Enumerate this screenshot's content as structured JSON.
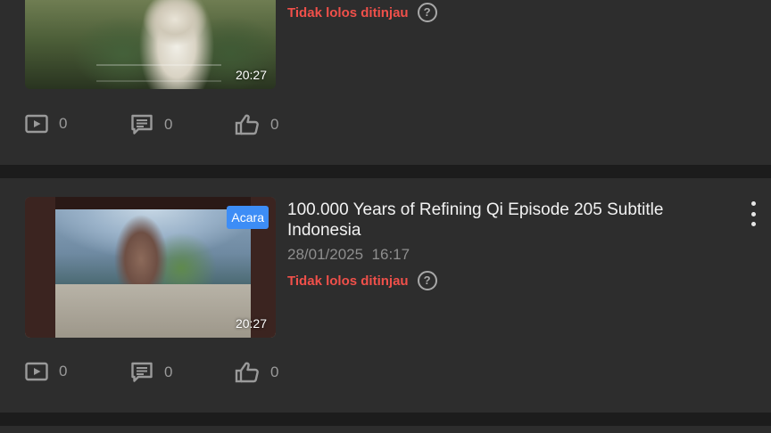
{
  "colors": {
    "background": "#1c1c1c",
    "card": "#2d2d2d",
    "status_red": "#f0504a",
    "badge_blue": "#3d8df6"
  },
  "videos": [
    {
      "duration": "20:27",
      "status": "Tidak lolos ditinjau",
      "stats": {
        "views": "0",
        "comments": "0",
        "likes": "0"
      }
    },
    {
      "badge": "Acara",
      "duration": "20:27",
      "title": "100.000 Years of Refining Qi Episode 205 Subtitle Indonesia",
      "date": "28/01/2025  16:17",
      "status": "Tidak lolos ditinjau",
      "stats": {
        "views": "0",
        "comments": "0",
        "likes": "0"
      }
    }
  ],
  "icons": {
    "views": "play-square-icon",
    "comments": "comment-icon",
    "likes": "thumbs-up-icon",
    "help": "question-circle-icon",
    "more": "more-vertical-icon"
  }
}
